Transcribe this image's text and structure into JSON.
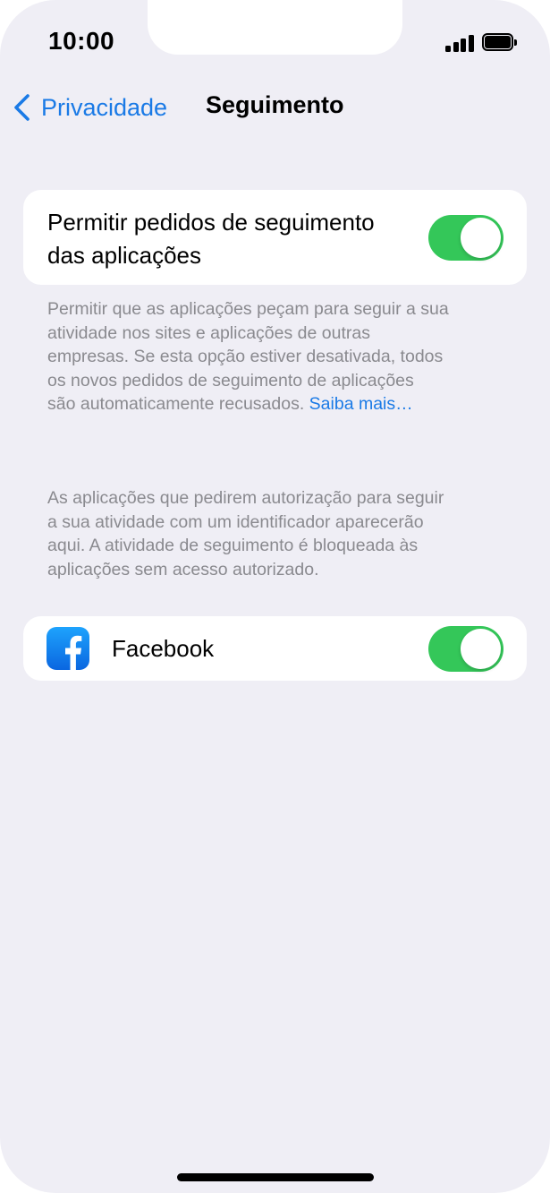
{
  "status_bar": {
    "time": "10:00",
    "signal_icon": "cellular-signal-icon",
    "battery_icon": "battery-icon"
  },
  "nav": {
    "back_label": "Privacidade",
    "back_icon": "chevron-left-icon",
    "title": "Seguimento"
  },
  "tracking_section": {
    "toggle_label_line1": "Permitir pedidos de seguimento",
    "toggle_label_line2": "das aplicações",
    "toggle_on": true,
    "footer_line1": "Permitir que as aplicações peçam para seguir a sua",
    "footer_line2": "atividade nos sites e aplicações de outras",
    "footer_line3": "empresas. Se esta opção estiver desativada, todos",
    "footer_line4": "os novos pedidos de seguimento de aplicações",
    "footer_line5": "são automaticamente recusados.",
    "footer_link": "Saiba mais…"
  },
  "apps_section": {
    "header_line1": "As aplicações que pedirem autorização para seguir",
    "header_line2": "a sua atividade com um identificador aparecerão",
    "header_line3": "aqui. A atividade de seguimento é bloqueada às",
    "header_line4": "aplicações sem acesso autorizado.",
    "apps": [
      {
        "name": "Facebook",
        "icon": "facebook-icon",
        "toggle_on": true
      }
    ]
  },
  "colors": {
    "accent": "#1a7ae6",
    "toggle_on": "#34c759",
    "background": "#efeef5",
    "secondary_text": "#8a8a8f"
  }
}
